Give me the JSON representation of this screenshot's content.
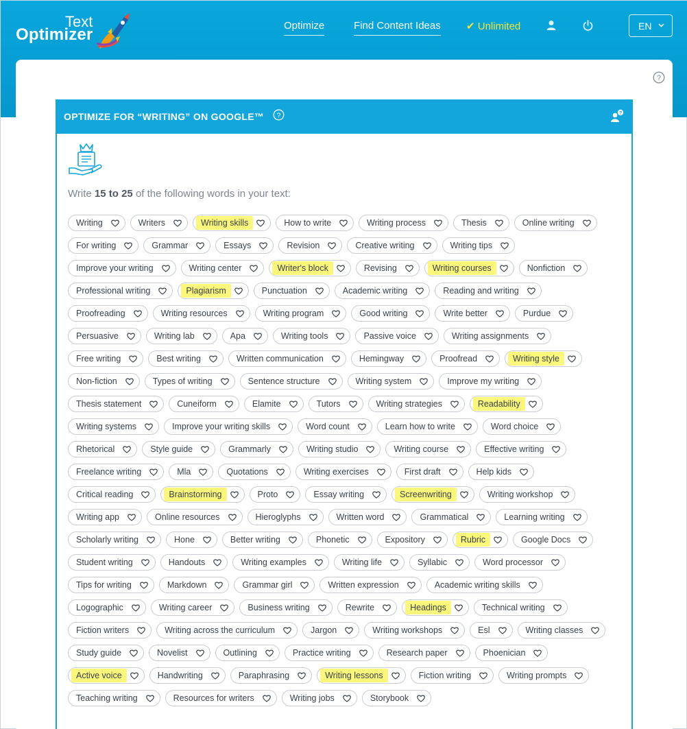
{
  "brand": {
    "line1": "Text",
    "line2": "Optimizer"
  },
  "nav": {
    "optimize": "Optimize",
    "find_ideas": "Find Content Ideas",
    "unlimited": "✔ Unlimited",
    "lang": "EN"
  },
  "panel": {
    "title": "OPTIMIZE FOR “WRITING” ON GOOGLE™",
    "instr_pre": "Write ",
    "instr_range": "15 to 25",
    "instr_post": " of the following words in your text:"
  },
  "colors": {
    "header": "#08a7dd",
    "accent": "#12a6dc",
    "highlight": "#fbf77a",
    "unlimited": "#f4e634"
  },
  "icons": [
    "user-icon",
    "power-icon",
    "chevron-down-icon",
    "help-icon",
    "user-question-icon",
    "heart-icon",
    "crown-document-hand-icon"
  ],
  "tags": [
    {
      "label": "Writing",
      "hl": false
    },
    {
      "label": "Writers",
      "hl": false
    },
    {
      "label": "Writing skills",
      "hl": true
    },
    {
      "label": "How to write",
      "hl": false
    },
    {
      "label": "Writing process",
      "hl": false
    },
    {
      "label": "Thesis",
      "hl": false
    },
    {
      "label": "Online writing",
      "hl": false
    },
    {
      "label": "For writing",
      "hl": false
    },
    {
      "label": "Grammar",
      "hl": false
    },
    {
      "label": "Essays",
      "hl": false
    },
    {
      "label": "Revision",
      "hl": false
    },
    {
      "label": "Creative writing",
      "hl": false
    },
    {
      "label": "Writing tips",
      "hl": false
    },
    {
      "label": "Improve your writing",
      "hl": false
    },
    {
      "label": "Writing center",
      "hl": false
    },
    {
      "label": "Writer's block",
      "hl": true
    },
    {
      "label": "Revising",
      "hl": false
    },
    {
      "label": "Writing courses",
      "hl": true
    },
    {
      "label": "Nonfiction",
      "hl": false
    },
    {
      "label": "Professional writing",
      "hl": false
    },
    {
      "label": "Plagiarism",
      "hl": true
    },
    {
      "label": "Punctuation",
      "hl": false
    },
    {
      "label": "Academic writing",
      "hl": false
    },
    {
      "label": "Reading and writing",
      "hl": false
    },
    {
      "label": "Proofreading",
      "hl": false
    },
    {
      "label": "Writing resources",
      "hl": false
    },
    {
      "label": "Writing program",
      "hl": false
    },
    {
      "label": "Good writing",
      "hl": false
    },
    {
      "label": "Write better",
      "hl": false
    },
    {
      "label": "Purdue",
      "hl": false
    },
    {
      "label": "Persuasive",
      "hl": false
    },
    {
      "label": "Writing lab",
      "hl": false
    },
    {
      "label": "Apa",
      "hl": false
    },
    {
      "label": "Writing tools",
      "hl": false
    },
    {
      "label": "Passive voice",
      "hl": false
    },
    {
      "label": "Writing assignments",
      "hl": false
    },
    {
      "label": "Free writing",
      "hl": false
    },
    {
      "label": "Best writing",
      "hl": false
    },
    {
      "label": "Written communication",
      "hl": false
    },
    {
      "label": "Hemingway",
      "hl": false
    },
    {
      "label": "Proofread",
      "hl": false
    },
    {
      "label": "Writing style",
      "hl": true
    },
    {
      "label": "Non-fiction",
      "hl": false
    },
    {
      "label": "Types of writing",
      "hl": false
    },
    {
      "label": "Sentence structure",
      "hl": false
    },
    {
      "label": "Writing system",
      "hl": false
    },
    {
      "label": "Improve my writing",
      "hl": false
    },
    {
      "label": "Thesis statement",
      "hl": false
    },
    {
      "label": "Cuneiform",
      "hl": false
    },
    {
      "label": "Elamite",
      "hl": false
    },
    {
      "label": "Tutors",
      "hl": false
    },
    {
      "label": "Writing strategies",
      "hl": false
    },
    {
      "label": "Readability",
      "hl": true
    },
    {
      "label": "Writing systems",
      "hl": false
    },
    {
      "label": "Improve your writing skills",
      "hl": false
    },
    {
      "label": "Word count",
      "hl": false
    },
    {
      "label": "Learn how to write",
      "hl": false
    },
    {
      "label": "Word choice",
      "hl": false
    },
    {
      "label": "Rhetorical",
      "hl": false
    },
    {
      "label": "Style guide",
      "hl": false
    },
    {
      "label": "Grammarly",
      "hl": false
    },
    {
      "label": "Writing studio",
      "hl": false
    },
    {
      "label": "Writing course",
      "hl": false
    },
    {
      "label": "Effective writing",
      "hl": false
    },
    {
      "label": "Freelance writing",
      "hl": false
    },
    {
      "label": "Mla",
      "hl": false
    },
    {
      "label": "Quotations",
      "hl": false
    },
    {
      "label": "Writing exercises",
      "hl": false
    },
    {
      "label": "First draft",
      "hl": false
    },
    {
      "label": "Help kids",
      "hl": false
    },
    {
      "label": "Critical reading",
      "hl": false
    },
    {
      "label": "Brainstorming",
      "hl": true
    },
    {
      "label": "Proto",
      "hl": false
    },
    {
      "label": "Essay writing",
      "hl": false
    },
    {
      "label": "Screenwriting",
      "hl": true
    },
    {
      "label": "Writing workshop",
      "hl": false
    },
    {
      "label": "Writing app",
      "hl": false
    },
    {
      "label": "Online resources",
      "hl": false
    },
    {
      "label": "Hieroglyphs",
      "hl": false
    },
    {
      "label": "Written word",
      "hl": false
    },
    {
      "label": "Grammatical",
      "hl": false
    },
    {
      "label": "Learning writing",
      "hl": false
    },
    {
      "label": "Scholarly writing",
      "hl": false
    },
    {
      "label": "Hone",
      "hl": false
    },
    {
      "label": "Better writing",
      "hl": false
    },
    {
      "label": "Phonetic",
      "hl": false
    },
    {
      "label": "Expository",
      "hl": false
    },
    {
      "label": "Rubric",
      "hl": true
    },
    {
      "label": "Google Docs",
      "hl": false
    },
    {
      "label": "Student writing",
      "hl": false
    },
    {
      "label": "Handouts",
      "hl": false
    },
    {
      "label": "Writing examples",
      "hl": false
    },
    {
      "label": "Writing life",
      "hl": false
    },
    {
      "label": "Syllabic",
      "hl": false
    },
    {
      "label": "Word processor",
      "hl": false
    },
    {
      "label": "Tips for writing",
      "hl": false
    },
    {
      "label": "Markdown",
      "hl": false
    },
    {
      "label": "Grammar girl",
      "hl": false
    },
    {
      "label": "Written expression",
      "hl": false
    },
    {
      "label": "Academic writing skills",
      "hl": false
    },
    {
      "label": "Logographic",
      "hl": false
    },
    {
      "label": "Writing career",
      "hl": false
    },
    {
      "label": "Business writing",
      "hl": false
    },
    {
      "label": "Rewrite",
      "hl": false
    },
    {
      "label": "Headings",
      "hl": true
    },
    {
      "label": "Technical writing",
      "hl": false
    },
    {
      "label": "Fiction writers",
      "hl": false
    },
    {
      "label": "Writing across the curriculum",
      "hl": false
    },
    {
      "label": "Jargon",
      "hl": false
    },
    {
      "label": "Writing workshops",
      "hl": false
    },
    {
      "label": "Esl",
      "hl": false
    },
    {
      "label": "Writing classes",
      "hl": false
    },
    {
      "label": "Study guide",
      "hl": false
    },
    {
      "label": "Novelist",
      "hl": false
    },
    {
      "label": "Outlining",
      "hl": false
    },
    {
      "label": "Practice writing",
      "hl": false
    },
    {
      "label": "Research paper",
      "hl": false
    },
    {
      "label": "Phoenician",
      "hl": false
    },
    {
      "label": "Active voice",
      "hl": true
    },
    {
      "label": "Handwriting",
      "hl": false
    },
    {
      "label": "Paraphrasing",
      "hl": false
    },
    {
      "label": "Writing lessons",
      "hl": true
    },
    {
      "label": "Fiction writing",
      "hl": false
    },
    {
      "label": "Writing prompts",
      "hl": false
    },
    {
      "label": "Teaching writing",
      "hl": false
    },
    {
      "label": "Resources for writers",
      "hl": false
    },
    {
      "label": "Writing jobs",
      "hl": false
    },
    {
      "label": "Storybook",
      "hl": false
    }
  ]
}
